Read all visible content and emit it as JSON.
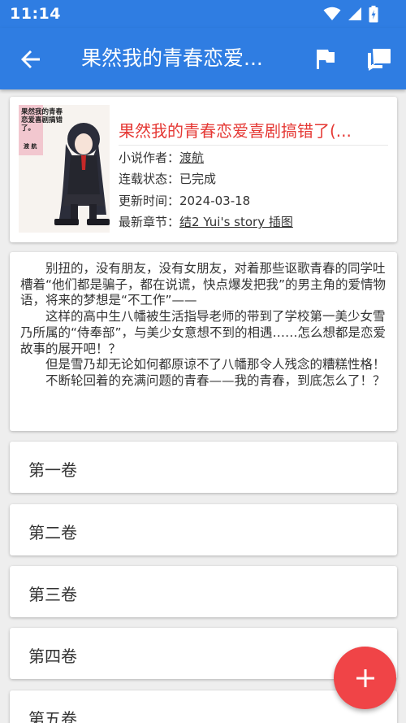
{
  "status_bar": {
    "time": "11:14",
    "icons": [
      "wifi-icon",
      "signal-icon",
      "battery-icon"
    ]
  },
  "app_bar": {
    "title": "果然我的青春恋爱...",
    "back_icon": "arrow-back-icon",
    "actions": [
      "flag-icon",
      "comment-icon"
    ],
    "color": "#2f7de2"
  },
  "book": {
    "title": "果然我的青春恋爱喜剧搞错了(...",
    "cover_text": "果然我的青春恋爱喜剧搞错了。",
    "cover_author": "渡 航",
    "author_label": "小说作者：",
    "author": "渡航",
    "status_label": "连载状态：",
    "status": "已完成",
    "updated_label": "更新时间：",
    "updated": "2024-03-18",
    "latest_label": "最新章节：",
    "latest": "结2 Yui's story 插图",
    "title_color": "#e53935"
  },
  "description": [
    "别扭的，没有朋友，没有女朋友，对着那些讴歌青春的同学吐槽着“他们都是骗子，都在说谎，快点爆发把我”的男主角的爱情物语，将来的梦想是“不工作”——",
    "这样的高中生八幡被生活指导老师的带到了学校第一美少女雪乃所属的“侍奉部”，与美少女意想不到的相遇……怎么想都是恋爱故事的展开吧！？",
    "但是雪乃却无论如何都原谅不了八幡那令人残念的糟糕性格！",
    "不断轮回着的充满问题的青春——我的青春，到底怎么了！？"
  ],
  "volumes": [
    "第一卷",
    "第二卷",
    "第三卷",
    "第四卷",
    "第五卷"
  ],
  "fab": {
    "icon": "plus-icon",
    "color": "#f04447"
  }
}
